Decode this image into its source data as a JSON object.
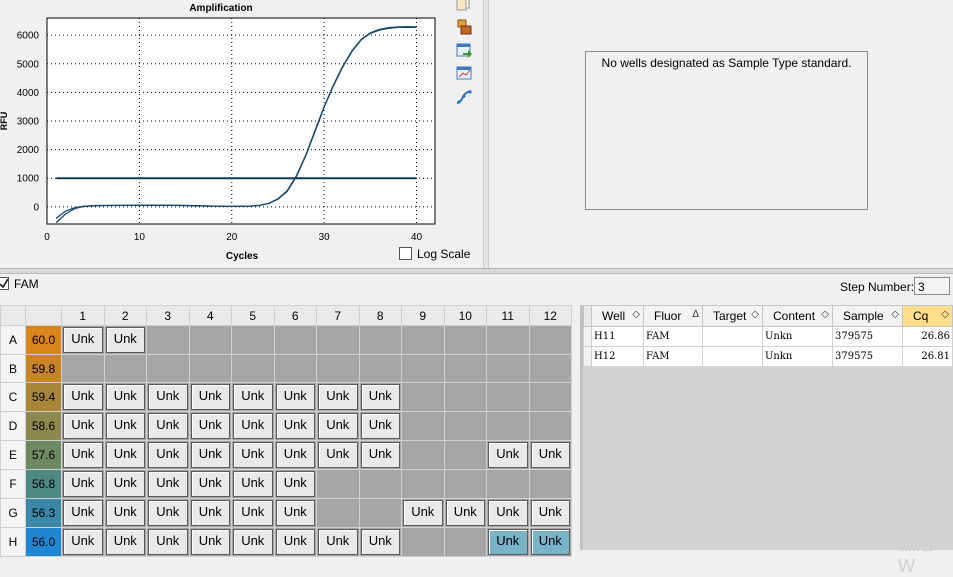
{
  "chart_data": {
    "type": "line",
    "title": "Amplification",
    "xlabel": "Cycles",
    "ylabel": "RFU",
    "xlim": [
      0,
      42
    ],
    "ylim": [
      -600,
      6600
    ],
    "xticks": [
      "0",
      "10",
      "20",
      "30",
      "40"
    ],
    "yticks": [
      "0",
      "1000",
      "2000",
      "3000",
      "4000",
      "5000",
      "6000"
    ],
    "grid": true,
    "threshold": 1000,
    "series": [
      {
        "x": [
          1,
          2,
          3,
          4,
          5,
          6,
          8,
          10,
          12,
          14,
          16,
          18,
          20,
          22,
          23,
          24,
          25,
          26,
          27,
          28,
          29,
          30,
          31,
          32,
          33,
          34,
          35,
          36,
          37,
          38,
          39,
          40
        ],
        "y": [
          -550,
          -250,
          -60,
          20,
          40,
          45,
          50,
          55,
          55,
          50,
          40,
          25,
          15,
          25,
          50,
          120,
          280,
          560,
          1080,
          1800,
          2650,
          3500,
          4250,
          4900,
          5450,
          5850,
          6080,
          6200,
          6260,
          6290,
          6300,
          6290
        ]
      },
      {
        "x": [
          1,
          2,
          3,
          4,
          5,
          6,
          8,
          10,
          12,
          14,
          16,
          18,
          20,
          22,
          23,
          24,
          25,
          26,
          27,
          28,
          29,
          30,
          31,
          32,
          33,
          34,
          35,
          36,
          37,
          38,
          39,
          40
        ],
        "y": [
          -400,
          -150,
          -30,
          20,
          40,
          45,
          50,
          55,
          55,
          50,
          40,
          25,
          15,
          25,
          50,
          115,
          270,
          540,
          1060,
          1780,
          2630,
          3480,
          4230,
          4880,
          5430,
          5830,
          6060,
          6180,
          6240,
          6270,
          6280,
          6270
        ]
      }
    ]
  },
  "chart": {
    "log_scale_label": "Log Scale",
    "line_color": "#17466e",
    "threshold_color": "#0e3a5a"
  },
  "standard_panel": {
    "message": "No wells designated as Sample Type standard."
  },
  "fluor_filter": {
    "label": "FAM"
  },
  "step": {
    "label": "Step Number:",
    "value": "3"
  },
  "plate": {
    "columns": [
      "1",
      "2",
      "3",
      "4",
      "5",
      "6",
      "7",
      "8",
      "9",
      "10",
      "11",
      "12"
    ],
    "rows": [
      {
        "row": "A",
        "temp": "60.0",
        "temp_color": "#d9851c",
        "wells": [
          "Unk",
          "Unk",
          "",
          "",
          "",
          "",
          "",
          "",
          "",
          "",
          "",
          ""
        ]
      },
      {
        "row": "B",
        "temp": "59.8",
        "temp_color": "#c78528",
        "wells": [
          "",
          "",
          "",
          "",
          "",
          "",
          "",
          "",
          "",
          "",
          "",
          ""
        ]
      },
      {
        "row": "C",
        "temp": "59.4",
        "temp_color": "#a88638",
        "wells": [
          "Unk",
          "Unk",
          "Unk",
          "Unk",
          "Unk",
          "Unk",
          "Unk",
          "Unk",
          "",
          "",
          "",
          ""
        ]
      },
      {
        "row": "D",
        "temp": "58.6",
        "temp_color": "#8b8950",
        "wells": [
          "Unk",
          "Unk",
          "Unk",
          "Unk",
          "Unk",
          "Unk",
          "Unk",
          "Unk",
          "",
          "",
          "",
          ""
        ]
      },
      {
        "row": "E",
        "temp": "57.6",
        "temp_color": "#6e8a62",
        "wells": [
          "Unk",
          "Unk",
          "Unk",
          "Unk",
          "Unk",
          "Unk",
          "Unk",
          "Unk",
          "",
          "",
          "Unk",
          "Unk"
        ]
      },
      {
        "row": "F",
        "temp": "56.8",
        "temp_color": "#4e8a82",
        "wells": [
          "Unk",
          "Unk",
          "Unk",
          "Unk",
          "Unk",
          "Unk",
          "",
          "",
          "",
          "",
          "",
          ""
        ]
      },
      {
        "row": "G",
        "temp": "56.3",
        "temp_color": "#3a87a8",
        "wells": [
          "Unk",
          "Unk",
          "Unk",
          "Unk",
          "Unk",
          "Unk",
          "",
          "",
          "Unk",
          "Unk",
          "Unk",
          "Unk"
        ]
      },
      {
        "row": "H",
        "temp": "56.0",
        "temp_color": "#1f86d3",
        "wells": [
          "Unk",
          "Unk",
          "Unk",
          "Unk",
          "Unk",
          "Unk",
          "Unk",
          "Unk",
          "",
          "",
          "Unk",
          "Unk"
        ]
      }
    ],
    "selected_wells": [
      "H11",
      "H12"
    ]
  },
  "results": {
    "headers": [
      "Well",
      "Fluor",
      "Target",
      "Content",
      "Sample",
      "Cq"
    ],
    "rows": [
      {
        "well": "H11",
        "fluor": "FAM",
        "target": "",
        "content": "Unkn",
        "sample": "379575",
        "cq": "26.86"
      },
      {
        "well": "H12",
        "fluor": "FAM",
        "target": "",
        "content": "Unkn",
        "sample": "379575",
        "cq": "26.81"
      }
    ]
  },
  "watermark": "激活 W"
}
